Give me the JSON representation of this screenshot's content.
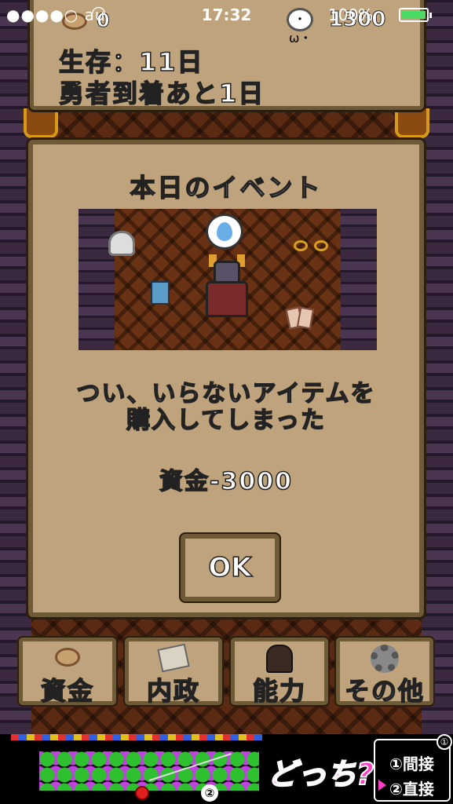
{
  "status_bar": {
    "carrier": "●●●●○ au",
    "time": "17:32",
    "battery_percent": "100%"
  },
  "info_panel": {
    "coin_count": "0",
    "money": "1300",
    "survival": "生存：11日",
    "hero_arrival": "勇者到着あと1日"
  },
  "event_dialog": {
    "title": "本日のイベント",
    "message_line1": "つい、いらないアイテムを",
    "message_line2": "購入してしまった",
    "effect": "資金-3000",
    "ok_label": "OK"
  },
  "menu": {
    "items": [
      {
        "label": "資金",
        "icon": "coin-icon"
      },
      {
        "label": "内政",
        "icon": "scroll-icon"
      },
      {
        "label": "能力",
        "icon": "monster-icon"
      },
      {
        "label": "その他",
        "icon": "gear-icon"
      }
    ]
  },
  "ad": {
    "headline": "どっち?",
    "option1": "①間接",
    "option2": "②直接",
    "marker": "②",
    "corner": "①"
  },
  "colors": {
    "panel": "#bfa37c",
    "panel_border": "#6e5a36",
    "ad_accent": "#ff3ec8"
  }
}
